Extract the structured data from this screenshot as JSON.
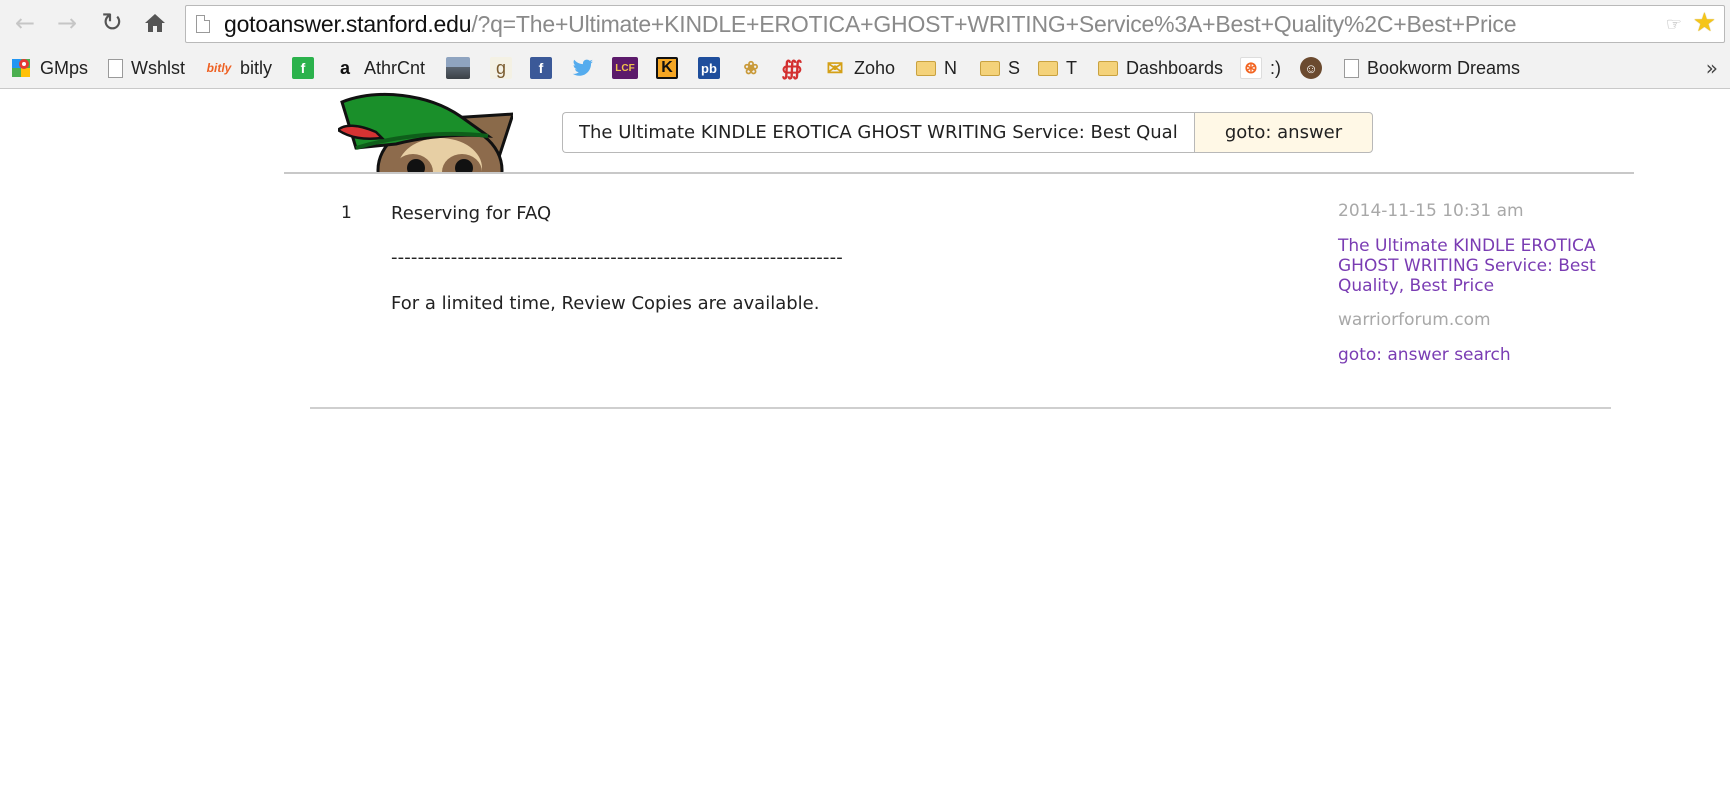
{
  "browser": {
    "url_host": "gotoanswer.stanford.edu",
    "url_path": "/?q=The+Ultimate+KINDLE+EROTICA+GHOST+WRITING+Service%3A+Best+Quality%2C+Best+Price",
    "bookmarks": [
      {
        "label": "GMps",
        "icon": "maps-pin-icon"
      },
      {
        "label": "Wshlst",
        "icon": "page-icon"
      },
      {
        "label": "bitly",
        "icon": "bitly-logo-icon",
        "icon_text": "bitly"
      },
      {
        "label": "",
        "icon": "feedly-icon",
        "icon_text": "f"
      },
      {
        "label": "AthrCnt",
        "icon": "amazon-icon",
        "icon_text": "a"
      },
      {
        "label": "",
        "icon": "landscape-image-icon"
      },
      {
        "label": "",
        "icon": "goodreads-icon",
        "icon_text": "g"
      },
      {
        "label": "",
        "icon": "facebook-icon",
        "icon_text": "f"
      },
      {
        "label": "",
        "icon": "twitter-icon"
      },
      {
        "label": "",
        "icon": "lcf-icon",
        "icon_text": "LCF"
      },
      {
        "label": "",
        "icon": "k-icon",
        "icon_text": "K"
      },
      {
        "label": "",
        "icon": "pb-icon",
        "icon_text": "pb"
      },
      {
        "label": "",
        "icon": "wheat-icon"
      },
      {
        "label": "",
        "icon": "swirl-icon"
      },
      {
        "label": "Zoho",
        "icon": "envelope-icon"
      },
      {
        "label": "N",
        "icon": "folder-icon"
      },
      {
        "label": "S",
        "icon": "folder-icon"
      },
      {
        "label": "T",
        "icon": "folder-icon"
      },
      {
        "label": "Dashboards",
        "icon": "folder-icon"
      },
      {
        "label": ":)",
        "icon": "orange-fork-icon"
      },
      {
        "label": "",
        "icon": "mailchimp-icon"
      },
      {
        "label": "Bookworm Dreams",
        "icon": "page-icon"
      }
    ],
    "overflow_chevron": "»"
  },
  "search": {
    "value": "The Ultimate KINDLE EROTICA GHOST WRITING Service: Best Quality, Best Price",
    "button_label": "goto: answer"
  },
  "result": {
    "number": "1",
    "title": "Reserving for FAQ",
    "separator": "--------------------------------------------------------------------",
    "body": "For a limited time, Review Copies are available."
  },
  "meta": {
    "date": "2014-11-15 10:31 am",
    "link_text": "The Ultimate KINDLE EROTICA GHOST WRITING Service: Best Quality, Best Price",
    "source": "warriorforum.com",
    "search_link": "goto: answer search"
  },
  "colors": {
    "visited_link": "#7a3cb3",
    "muted_text": "#a8a8a8",
    "button_bg": "#fff8e6"
  }
}
